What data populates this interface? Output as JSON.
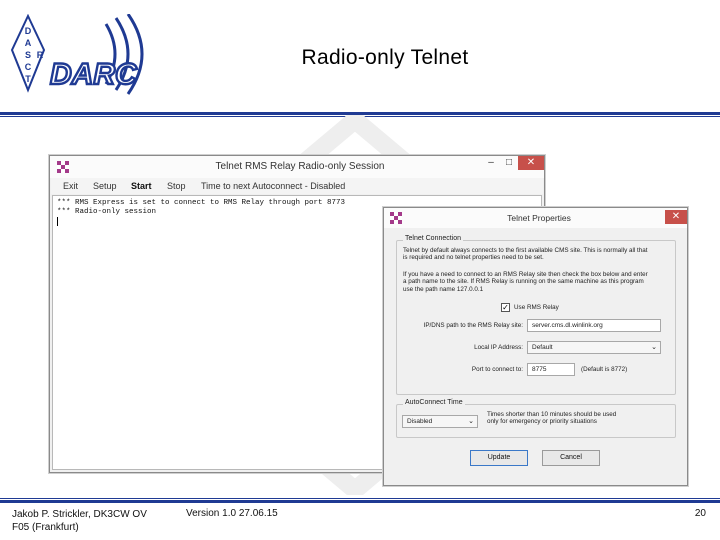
{
  "logo": {
    "text": "DARC",
    "ring_text": "DASCTR"
  },
  "slide": {
    "title": "Radio-only Telnet",
    "footer_author_line1": "Jakob P. Strickler, DK3CW OV",
    "footer_author_line2": "F05 (Frankfurt)",
    "footer_version": "Version 1.0  27.06.15",
    "page_number": "20"
  },
  "session_window": {
    "title": "Telnet RMS Relay Radio-only Session",
    "buttons": {
      "minimize": "–",
      "maximize": "□",
      "close": "✕"
    },
    "menu": {
      "exit": "Exit",
      "setup": "Setup",
      "start": "Start",
      "stop": "Stop",
      "status": "Time to next Autoconnect - Disabled"
    },
    "console_lines": [
      "*** RMS Express is set to connect to RMS Relay through port 8773",
      "*** Radio-only session"
    ]
  },
  "properties_dialog": {
    "title": "Telnet Properties",
    "close": "✕",
    "telnet_connection": {
      "legend": "Telnet Connection",
      "text1_l1": "Telnet by default always connects to the first available CMS site. This is normally all that",
      "text1_l2": "is required and no telnet properties need to be set.",
      "text2_l1": "If you have a need to connect to an RMS Relay site then check the box below and enter",
      "text2_l2": "a path name to the site. If RMS Relay is running on the same machine as this program",
      "text2_l3": "use the path name 127.0.0.1",
      "use_rms_relay_label": "Use RMS Relay",
      "use_rms_relay_checked": "✓",
      "ip_label": "IP/DNS path to the RMS Relay site:",
      "ip_value": "server.cms.dl.winlink.org",
      "local_ip_label": "Local IP Address:",
      "local_ip_value": "Default",
      "port_label": "Port to connect to:",
      "port_value": "8775",
      "port_note": "(Default is 8772)"
    },
    "autoconnect": {
      "legend": "AutoConnect Time",
      "select_value": "Disabled",
      "note_l1": "Times shorter than 10 minutes should be used",
      "note_l2": "only for emergency or priority situations"
    },
    "update_button": "Update",
    "cancel_button": "Cancel"
  }
}
